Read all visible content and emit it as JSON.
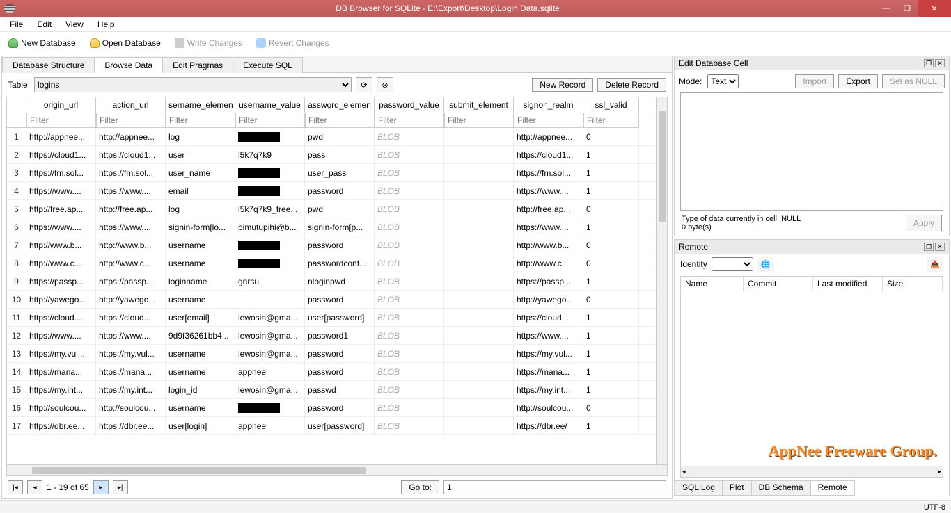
{
  "title": "DB Browser for SQLite - E:\\Export\\Desktop\\Login Data.sqlite",
  "menu": {
    "file": "File",
    "edit": "Edit",
    "view": "View",
    "help": "Help"
  },
  "toolbar": {
    "new": "New Database",
    "open": "Open Database",
    "write": "Write Changes",
    "revert": "Revert Changes"
  },
  "tabs": {
    "structure": "Database Structure",
    "browse": "Browse Data",
    "pragmas": "Edit Pragmas",
    "sql": "Execute SQL"
  },
  "tablebar": {
    "label": "Table:",
    "selected": "logins",
    "newrec": "New Record",
    "delrec": "Delete Record"
  },
  "columns": [
    "",
    "origin_url",
    "action_url",
    "sername_elemen",
    "username_value",
    "assword_elemen",
    "password_value",
    "submit_element",
    "signon_realm",
    "ssl_valid"
  ],
  "filter": "Filter",
  "rows": [
    {
      "n": "1",
      "c": [
        "http://appnee...",
        "http://appnee...",
        "log",
        "[REDACTED]",
        "pwd",
        "BLOB",
        "",
        "http://appnee...",
        "0"
      ]
    },
    {
      "n": "2",
      "c": [
        "https://cloud1...",
        "https://cloud1...",
        "user",
        "l5k7q7k9",
        "pass",
        "BLOB",
        "",
        "https://cloud1...",
        "1"
      ]
    },
    {
      "n": "3",
      "c": [
        "https://fm.sol...",
        "https://fm.sol...",
        "user_name",
        "[REDACTED]",
        "user_pass",
        "BLOB",
        "",
        "https://fm.sol...",
        "1"
      ]
    },
    {
      "n": "4",
      "c": [
        "https://www....",
        "https://www....",
        "email",
        "[REDACTED]",
        "password",
        "BLOB",
        "",
        "https://www....",
        "1"
      ]
    },
    {
      "n": "5",
      "c": [
        "http://free.ap...",
        "http://free.ap...",
        "log",
        "l5k7q7k9_free...",
        "pwd",
        "BLOB",
        "",
        "http://free.ap...",
        "0"
      ]
    },
    {
      "n": "6",
      "c": [
        "https://www....",
        "https://www....",
        "signin-form[lo...",
        "pimutupihi@b...",
        "signin-form[p...",
        "BLOB",
        "",
        "https://www....",
        "1"
      ]
    },
    {
      "n": "7",
      "c": [
        "http://www.b...",
        "http://www.b...",
        "username",
        "[REDACTED]",
        "password",
        "BLOB",
        "",
        "http://www.b...",
        "0"
      ]
    },
    {
      "n": "8",
      "c": [
        "http://www.c...",
        "http://www.c...",
        "username",
        "[REDACTED]",
        "passwordconf...",
        "BLOB",
        "",
        "http://www.c...",
        "0"
      ]
    },
    {
      "n": "9",
      "c": [
        "https://passp...",
        "https://passp...",
        "loginname",
        "gnrsu",
        "nloginpwd",
        "BLOB",
        "",
        "https://passp...",
        "1"
      ]
    },
    {
      "n": "10",
      "c": [
        "http://yawego...",
        "http://yawego...",
        "username",
        "",
        "password",
        "BLOB",
        "",
        "http://yawego...",
        "0"
      ]
    },
    {
      "n": "11",
      "c": [
        "https://cloud...",
        "https://cloud...",
        "user[email]",
        "lewosin@gma...",
        "user[password]",
        "BLOB",
        "",
        "https://cloud...",
        "1"
      ]
    },
    {
      "n": "12",
      "c": [
        "https://www....",
        "https://www....",
        "9d9f36261bb4...",
        "lewosin@gma...",
        "password1",
        "BLOB",
        "",
        "https://www....",
        "1"
      ]
    },
    {
      "n": "13",
      "c": [
        "https://my.vul...",
        "https://my.vul...",
        "username",
        "lewosin@gma...",
        "password",
        "BLOB",
        "",
        "https://my.vul...",
        "1"
      ]
    },
    {
      "n": "14",
      "c": [
        "https://mana...",
        "https://mana...",
        "username",
        "appnee",
        "password",
        "BLOB",
        "",
        "https://mana...",
        "1"
      ]
    },
    {
      "n": "15",
      "c": [
        "https://my.int...",
        "https://my.int...",
        "login_id",
        "lewosin@gma...",
        "passwd",
        "BLOB",
        "",
        "https://my.int...",
        "1"
      ]
    },
    {
      "n": "16",
      "c": [
        "http://soulcou...",
        "http://soulcou...",
        "username",
        "[REDACTED]",
        "password",
        "BLOB",
        "",
        "http://soulcou...",
        "0"
      ]
    },
    {
      "n": "17",
      "c": [
        "https://dbr.ee...",
        "https://dbr.ee...",
        "user[login]",
        "appnee",
        "user[password]",
        "BLOB",
        "",
        "https://dbr.ee/",
        "1"
      ]
    }
  ],
  "pager": {
    "range": "1 - 19 of 65",
    "goto": "Go to:",
    "gotoval": "1"
  },
  "cellpanel": {
    "title": "Edit Database Cell",
    "mode": "Mode:",
    "modval": "Text",
    "import": "Import",
    "export": "Export",
    "setnull": "Set as NULL",
    "info1": "Type of data currently in cell: NULL",
    "info2": "0 byte(s)",
    "apply": "Apply"
  },
  "remote": {
    "title": "Remote",
    "identity": "Identity",
    "cols": {
      "name": "Name",
      "commit": "Commit",
      "lastmod": "Last modified",
      "size": "Size"
    }
  },
  "bottomtabs": {
    "sqllog": "SQL Log",
    "plot": "Plot",
    "schema": "DB Schema",
    "remote": "Remote"
  },
  "status": "UTF-8",
  "watermark": "AppNee Freeware Group."
}
